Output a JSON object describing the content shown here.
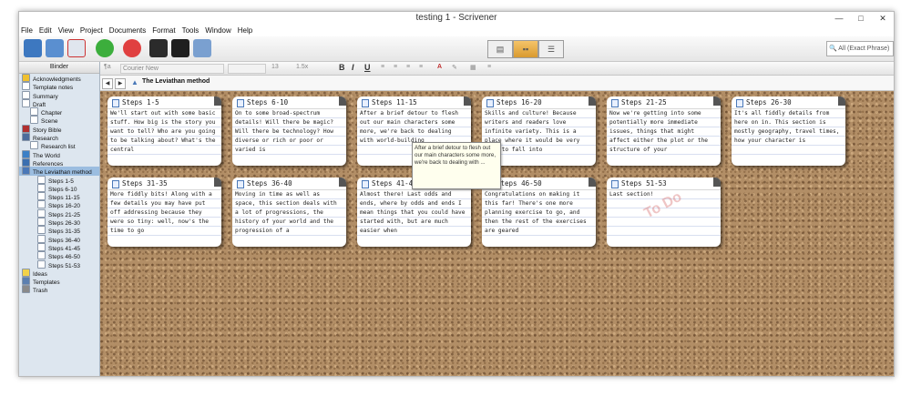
{
  "window": {
    "title": "testing 1 - Scrivener"
  },
  "menu": [
    "File",
    "Edit",
    "View",
    "Project",
    "Documents",
    "Format",
    "Tools",
    "Window",
    "Help"
  ],
  "toolbar": {
    "search_placeholder": "All (Exact Phrase)"
  },
  "format_bar": {
    "style": "¶a",
    "font": "Courier New",
    "size": "13",
    "line_spacing": "1.5x",
    "bold": "B",
    "italic": "I",
    "underline": "U"
  },
  "binder": {
    "header": "Binder",
    "items": [
      {
        "label": "Acknowledgments",
        "icon": "star-icon",
        "color": "#f0c030"
      },
      {
        "label": "Template notes",
        "icon": "document-icon",
        "color": "#ffffff"
      },
      {
        "label": "Summary",
        "icon": "document-icon",
        "color": "#ffffff"
      },
      {
        "label": "Draft",
        "icon": "draft-folder-icon",
        "color": "#ffffff"
      },
      {
        "label": "Chapter",
        "icon": "document-icon",
        "color": "#ffffff"
      },
      {
        "label": "Scene",
        "icon": "document-icon",
        "color": "#ffffff"
      },
      {
        "label": "Story Bible",
        "icon": "book-icon",
        "color": "#b03030"
      },
      {
        "label": "Research",
        "icon": "research-icon",
        "color": "#4d6c9c"
      },
      {
        "label": "Research list",
        "icon": "document-icon",
        "color": "#ffffff"
      },
      {
        "label": "The World",
        "icon": "globe-icon",
        "color": "#3b7fc6"
      },
      {
        "label": "References",
        "icon": "references-icon",
        "color": "#3a6fb0"
      },
      {
        "label": "The Leviathan method",
        "icon": "warning-icon",
        "color": "#4a78b8",
        "selected": true
      },
      {
        "label": "Steps 1-5",
        "icon": "document-icon",
        "color": "#ffffff"
      },
      {
        "label": "Steps 6-10",
        "icon": "document-icon",
        "color": "#ffffff"
      },
      {
        "label": "Steps 11-15",
        "icon": "document-icon",
        "color": "#ffffff"
      },
      {
        "label": "Steps 16-20",
        "icon": "document-icon",
        "color": "#ffffff"
      },
      {
        "label": "Steps 21-25",
        "icon": "document-icon",
        "color": "#ffffff"
      },
      {
        "label": "Steps 26-30",
        "icon": "document-icon",
        "color": "#ffffff"
      },
      {
        "label": "Steps 31-35",
        "icon": "document-icon",
        "color": "#ffffff"
      },
      {
        "label": "Steps 36-40",
        "icon": "document-icon",
        "color": "#ffffff"
      },
      {
        "label": "Steps 41-45",
        "icon": "document-icon",
        "color": "#ffffff"
      },
      {
        "label": "Steps 46-50",
        "icon": "document-icon",
        "color": "#ffffff"
      },
      {
        "label": "Steps 51-53",
        "icon": "document-icon",
        "color": "#ffffff"
      },
      {
        "label": "Ideas",
        "icon": "lightbulb-icon",
        "color": "#f2d24a"
      },
      {
        "label": "Templates",
        "icon": "templates-icon",
        "color": "#5b7fb0"
      },
      {
        "label": "Trash",
        "icon": "trash-icon",
        "color": "#8a8a8a"
      }
    ]
  },
  "header": {
    "title": "The Leviathan method"
  },
  "cards": [
    {
      "title": "Steps 1-5",
      "text": "We'll start out with some basic stuff. How big is the story you want to tell? Who are you going to be talking about? What's the central",
      "stamp": ""
    },
    {
      "title": "Steps 6-10",
      "text": "On to some broad-spectrum details! Will there be magic? Will there be technology? How diverse or rich or poor or varied is",
      "stamp": ""
    },
    {
      "title": "Steps 11-15",
      "text": "After a brief detour to flesh out our main characters some more, we're back to dealing with world-building",
      "stamp": ""
    },
    {
      "title": "Steps 16-20",
      "text": "Skills and culture! Because writers and readers love infinite variety. This is a place where it would be very easy to fall into",
      "stamp": ""
    },
    {
      "title": "Steps 21-25",
      "text": "Now we're getting into some potentially more immediate issues, things that might affect either the plot or the structure of your",
      "stamp": ""
    },
    {
      "title": "Steps 26-30",
      "text": "It's all fiddly details from here on in. This section is mostly geography, travel times, how your character is",
      "stamp": ""
    },
    {
      "title": "Steps 31-35",
      "text": "More fiddly bits! Along with a few details you may have put off addressing because they were so tiny: well, now's the time to go",
      "stamp": ""
    },
    {
      "title": "Steps 36-40",
      "text": "Moving in time as well as space, this section deals with a lot of progressions, the history of your world and the progression of a",
      "stamp": ""
    },
    {
      "title": "Steps 41-45",
      "text": "Almost there! Last odds and ends, where by odds and ends I mean things that you could have started with, but are much easier when",
      "stamp": ""
    },
    {
      "title": "Steps 46-50",
      "text": "Congratulations on making it this far! There's one more planning exercise to go, and then the rest of the exercises are geared",
      "stamp": ""
    },
    {
      "title": "Steps 51-53",
      "text": "Last section!",
      "stamp": "To Do"
    }
  ],
  "tooltip": {
    "text": "After a brief detour to flesh out our main characters some more, we're back to dealing with ..."
  },
  "colors": {
    "corkboard": "#b28e66",
    "selection": "#9bbde0",
    "active_view": "#e0a73d"
  }
}
